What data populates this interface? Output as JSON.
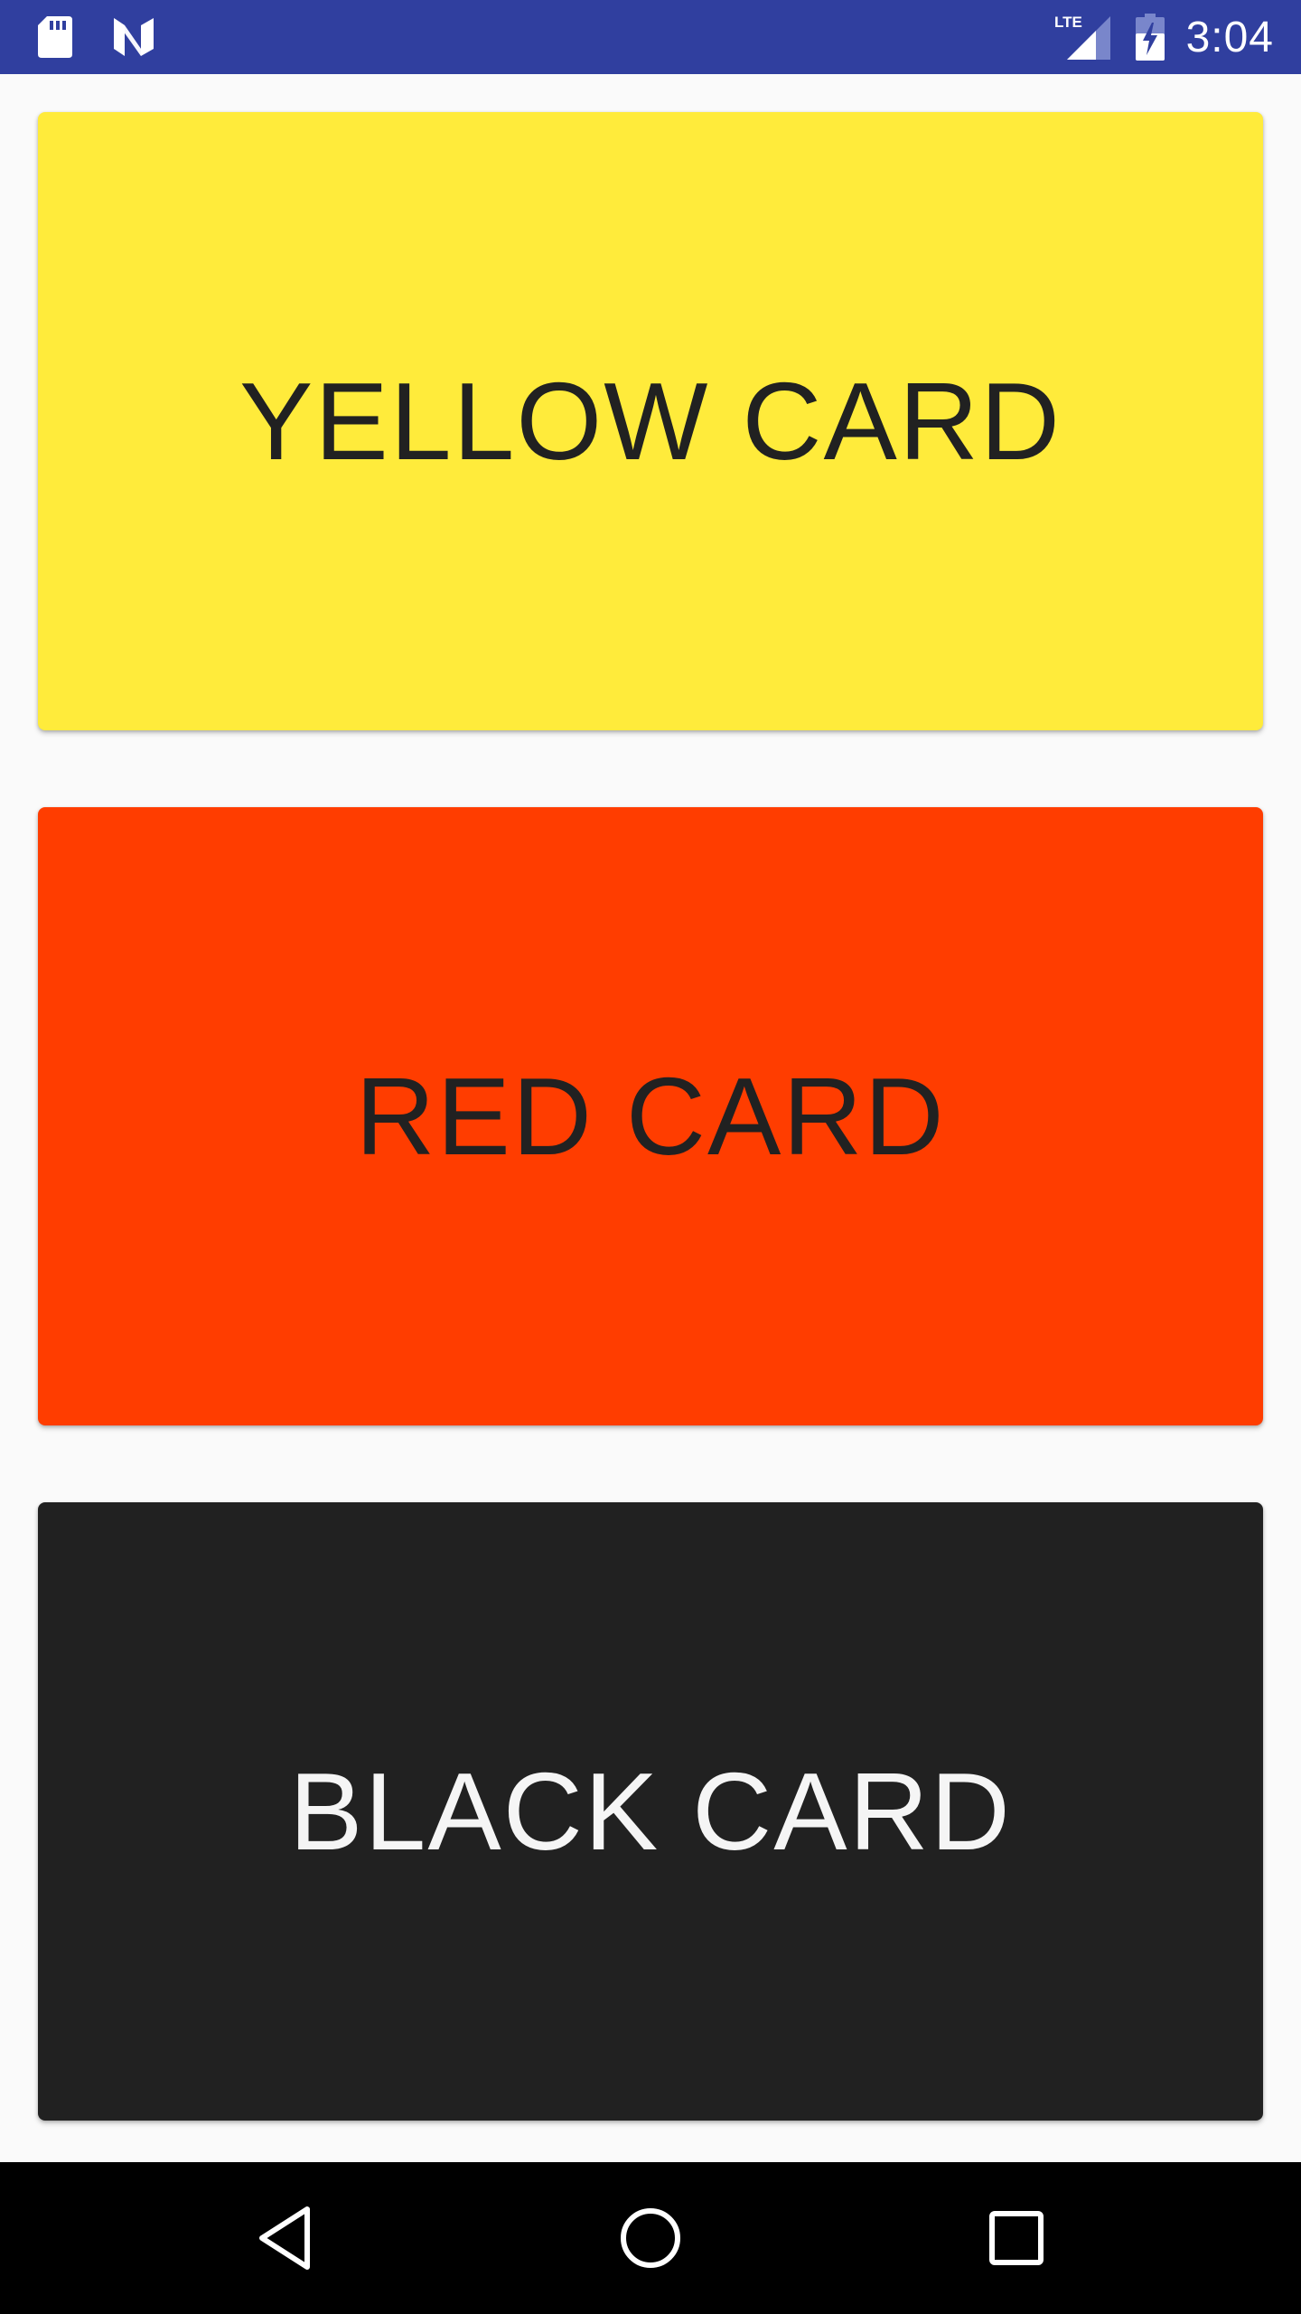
{
  "status_bar": {
    "time": "3:04",
    "network_label": "LTE",
    "background_color": "#303f9f",
    "icons": {
      "left": [
        "sd-card-icon",
        "n-logo-icon"
      ],
      "right": [
        "lte-signal-icon",
        "battery-charging-icon"
      ]
    }
  },
  "cards": [
    {
      "label": "YELLOW CARD",
      "background_color": "#ffeb3b",
      "text_color": "#212121"
    },
    {
      "label": "RED CARD",
      "background_color": "#ff3d00",
      "text_color": "#212121"
    },
    {
      "label": "BLACK CARD",
      "background_color": "#212121",
      "text_color": "#f5f5f5"
    }
  ],
  "nav_bar": {
    "background_color": "#000000",
    "buttons": [
      "back-icon",
      "home-icon",
      "recents-icon"
    ]
  }
}
